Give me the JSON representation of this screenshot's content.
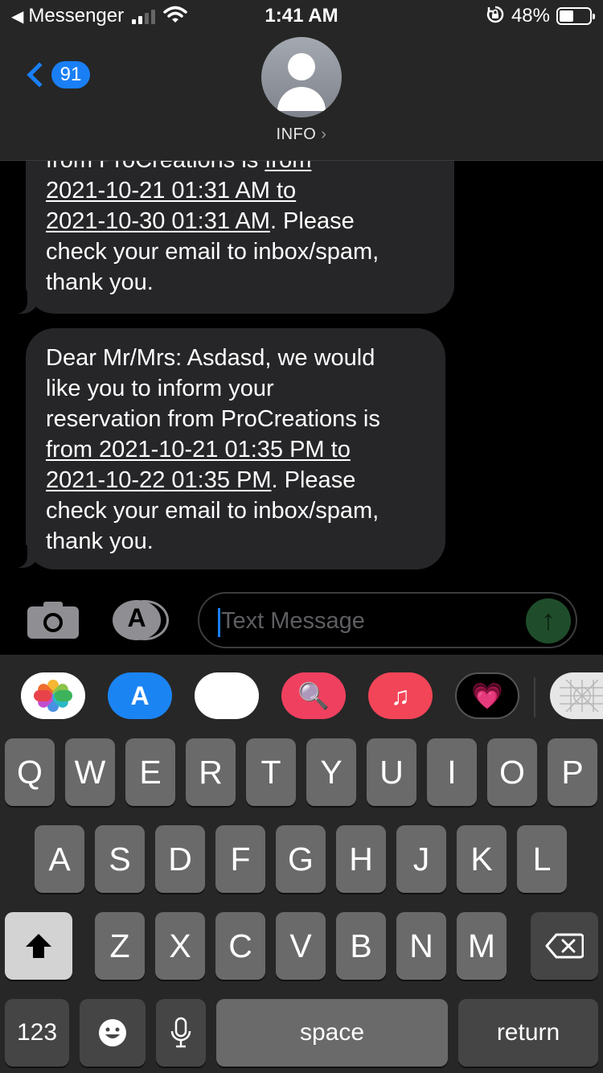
{
  "status_bar": {
    "back_app": "Messenger",
    "time": "1:41 AM",
    "battery_percent": "48%",
    "battery_level": 0.48,
    "signal_bars": 2,
    "icons": [
      "back-triangle-icon",
      "signal-icon",
      "wifi-icon",
      "orientation-lock-icon",
      "battery-icon"
    ]
  },
  "header": {
    "back_count": "91",
    "contact_name": "INFO",
    "contact_arrow": "›"
  },
  "messages": [
    {
      "lines": [
        [
          {
            "t": "from ProCreations is ",
            "u": false
          },
          {
            "t": "from",
            "u": true
          }
        ],
        [
          {
            "t": "2021-10-21 01:31 AM to",
            "u": true
          }
        ],
        [
          {
            "t": "2021-10-30 01:31 AM",
            "u": true
          },
          {
            "t": ". Please",
            "u": false
          }
        ],
        [
          {
            "t": "check your email to inbox/spam,",
            "u": false
          }
        ],
        [
          {
            "t": "thank you.",
            "u": false
          }
        ]
      ]
    },
    {
      "lines": [
        [
          {
            "t": "Dear Mr/Mrs: Asdasd, we would",
            "u": false
          }
        ],
        [
          {
            "t": "like you to inform your",
            "u": false
          }
        ],
        [
          {
            "t": "reservation from ProCreations is",
            "u": false
          }
        ],
        [
          {
            "t": "from 2021-10-21 01:35 PM to",
            "u": true
          }
        ],
        [
          {
            "t": "2021-10-22 01:35 PM",
            "u": true
          },
          {
            "t": ". Please",
            "u": false
          }
        ],
        [
          {
            "t": "check your email to inbox/spam,",
            "u": false
          }
        ],
        [
          {
            "t": "thank you.",
            "u": false
          }
        ]
      ]
    }
  ],
  "input_bar": {
    "placeholder": "Text Message",
    "send_glyph": "↑",
    "apps_glyph": "A"
  },
  "app_drawer": {
    "apps": [
      {
        "name": "photos-app-icon",
        "glyph": ""
      },
      {
        "name": "app-store-app-icon",
        "glyph": "A"
      },
      {
        "name": "memoji-app-icon",
        "glyph": "😍"
      },
      {
        "name": "search-images-app-icon",
        "glyph": "🔍"
      },
      {
        "name": "music-app-icon",
        "glyph": "♫"
      },
      {
        "name": "digital-touch-app-icon",
        "glyph": "💗"
      },
      {
        "name": "stickers-app-icon",
        "glyph": "⊗"
      }
    ]
  },
  "keyboard": {
    "row1": [
      "Q",
      "W",
      "E",
      "R",
      "T",
      "Y",
      "U",
      "I",
      "O",
      "P"
    ],
    "row2": [
      "A",
      "S",
      "D",
      "F",
      "G",
      "H",
      "J",
      "K",
      "L"
    ],
    "row3": [
      "Z",
      "X",
      "C",
      "V",
      "B",
      "N",
      "M"
    ],
    "shift": "⬆",
    "delete": "⌫",
    "numbers": "123",
    "emoji": "☻",
    "dictation": "🎤",
    "space": "space",
    "return": "return"
  },
  "colors": {
    "accent": "#1a7ff5",
    "bubble": "#262628",
    "keyboard_bg": "#272727",
    "key": "#6a6a6a",
    "key_dark": "#454545"
  }
}
